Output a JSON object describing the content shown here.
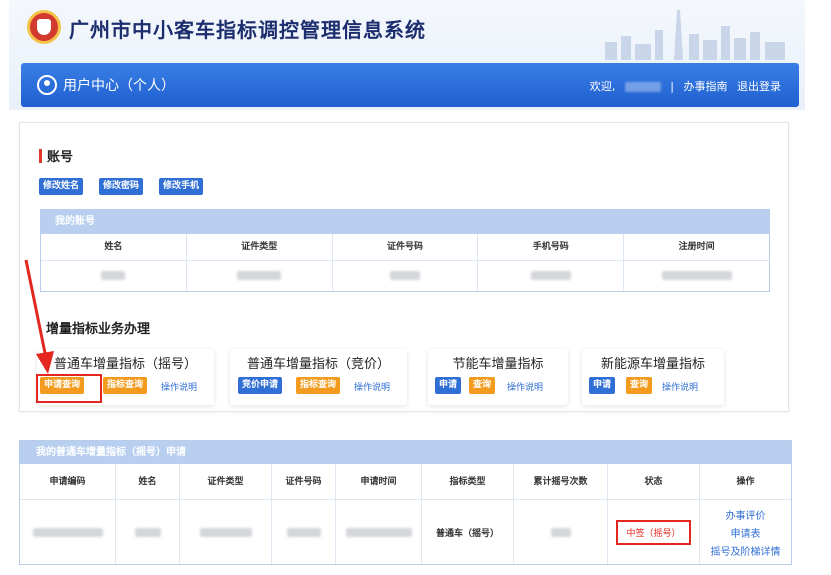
{
  "header": {
    "site_title": "广州市中小客车指标调控管理信息系统",
    "user_center": "用户中心（个人）",
    "welcome": "欢迎,",
    "separator": "|",
    "guide_link": "办事指南",
    "logout_link": "退出登录"
  },
  "account": {
    "section_title": "账号",
    "buttons": [
      "修改姓名",
      "修改密码",
      "修改手机"
    ],
    "table_title": "我的账号",
    "columns": [
      "姓名",
      "证件类型",
      "证件号码",
      "手机号码",
      "注册时间"
    ]
  },
  "business": {
    "section_title": "增量指标业务办理",
    "cards": [
      {
        "title": "普通车增量指标（摇号）",
        "btn1": "申请查询",
        "btn2": "指标查询",
        "link": "操作说明"
      },
      {
        "title": "普通车增量指标（竞价）",
        "btn1": "竞价申请",
        "btn2": "指标查询",
        "link": "操作说明"
      },
      {
        "title": "节能车增量指标",
        "btn1": "申请",
        "btn2": "查询",
        "link": "操作说明"
      },
      {
        "title": "新能源车增量指标",
        "btn1": "申请",
        "btn2": "查询",
        "link": "操作说明"
      }
    ]
  },
  "applications": {
    "title": "我的普通车增量指标（摇号）申请",
    "columns": [
      "申请编码",
      "姓名",
      "证件类型",
      "证件号码",
      "申请时间",
      "指标类型",
      "累计摇号次数",
      "状态",
      "操作"
    ],
    "row": {
      "index_type": "普通车（摇号）",
      "status": "中签（摇号）",
      "actions": [
        "办事评价",
        "申请表",
        "摇号及阶梯详情"
      ]
    }
  },
  "colors": {
    "primary_blue": "#2f6fd6",
    "orange": "#f29b1e",
    "highlight_red": "#e3271f",
    "table_header": "#b8cff0"
  }
}
